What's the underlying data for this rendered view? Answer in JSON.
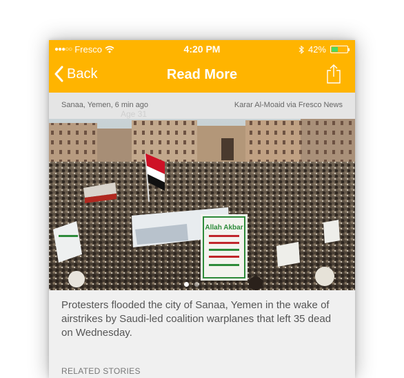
{
  "status_bar": {
    "carrier": "Fresco",
    "time": "4:20 PM",
    "battery_percent": "42%",
    "battery_level": 0.42
  },
  "nav": {
    "back_label": "Back",
    "title": "Read More"
  },
  "meta": {
    "location_time": "Sanaa, Yemen, 6 min ago",
    "credit": "Karar Al-Moaid via Fresco News",
    "ghost_text": "Age   31"
  },
  "photo": {
    "banner_text": "Allah Akbar",
    "pages": 2,
    "active_page": 1
  },
  "caption": "Protesters flooded the city of Sanaa, Yemen in the wake of airstrikes by Saudi-led coalition warplanes that left 35 dead on Wednesday.",
  "related_heading": "RELATED STORIES",
  "colors": {
    "accent": "#ffb400",
    "meta_bg": "#e5e5e5",
    "battery_green": "#4cd964"
  }
}
